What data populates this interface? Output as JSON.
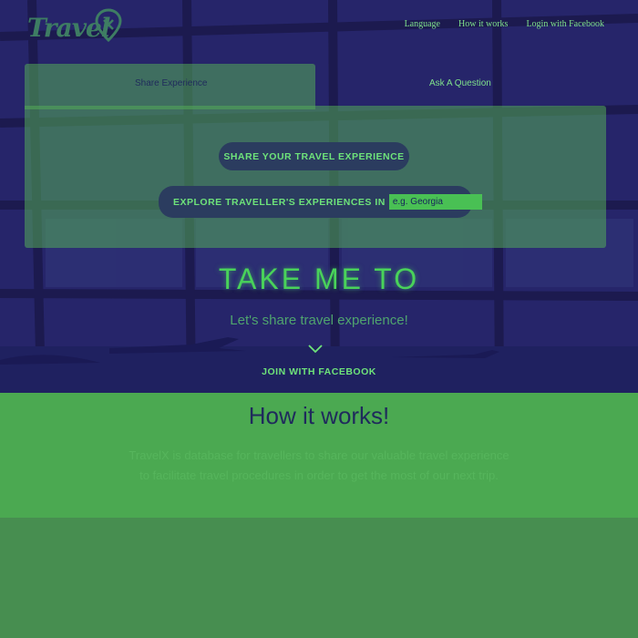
{
  "brand": {
    "logo_text": "Travel"
  },
  "nav": {
    "items": [
      "Language",
      "How it works",
      "Login with Facebook"
    ]
  },
  "panel": {
    "tabs": {
      "share": "Share Experience",
      "ask": "Ask A Question"
    },
    "share_button": "SHARE YOUR TRAVEL EXPERIENCE",
    "explore_label": "EXPLORE TRAVELLER'S EXPERIENCES IN",
    "destination_placeholder": "e.g. Georgia",
    "destination_value": ""
  },
  "hero": {
    "title": "TAKE ME TO",
    "subtitle": "Let's share travel experience!",
    "join_label": "JOIN WITH FACEBOOK"
  },
  "how": {
    "title": "How it works!",
    "description": "TravelX is database for travellers to share our valuable travel experience to facilitate travel procedures in order to get the most of our next trip."
  },
  "colors": {
    "hero_bg": "#26256a",
    "accent_green": "#49d25a",
    "panel_green": "#53ac57",
    "how_bg": "#4ba951",
    "footer_bg": "#478e50",
    "pill_bg": "#2b3c5f"
  },
  "icons": {
    "logo_pin": "location-pin-icon",
    "scroll_down": "chevron-down-icon"
  }
}
